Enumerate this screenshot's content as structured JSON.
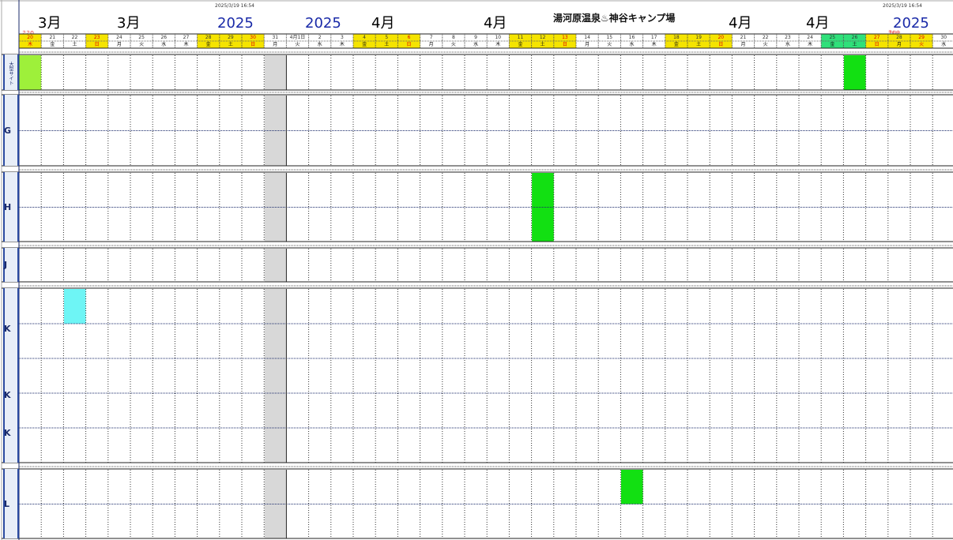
{
  "sheet": {
    "timestamp": "2025/3/19 16:54",
    "title": "湯河原温泉♨神谷キャンプ場",
    "banner": [
      "3月",
      "3月",
      "2025",
      "2025",
      "4月",
      "4月",
      "4月",
      "4月",
      "2025"
    ],
    "notes": {
      "left": "ささの",
      "right": "予約中"
    }
  },
  "days": [
    {
      "d": "20",
      "w": "木",
      "c": "#f5e400",
      "red": true
    },
    {
      "d": "21",
      "w": "金",
      "c": null,
      "red": false
    },
    {
      "d": "22",
      "w": "土",
      "c": null,
      "red": false
    },
    {
      "d": "23",
      "w": "日",
      "c": "#f5e400",
      "red": true
    },
    {
      "d": "24",
      "w": "月",
      "c": null,
      "red": false
    },
    {
      "d": "25",
      "w": "火",
      "c": null,
      "red": false
    },
    {
      "d": "26",
      "w": "水",
      "c": null,
      "red": false
    },
    {
      "d": "27",
      "w": "木",
      "c": null,
      "red": false
    },
    {
      "d": "28",
      "w": "金",
      "c": "#f5e400",
      "red": false
    },
    {
      "d": "29",
      "w": "土",
      "c": "#f5e400",
      "red": false
    },
    {
      "d": "30",
      "w": "日",
      "c": "#f5e400",
      "red": true
    },
    {
      "d": "31",
      "w": "月",
      "c": null,
      "red": false
    },
    {
      "d": "4月1日",
      "w": "火",
      "c": null,
      "red": false
    },
    {
      "d": "2",
      "w": "水",
      "c": null,
      "red": false
    },
    {
      "d": "3",
      "w": "木",
      "c": null,
      "red": false
    },
    {
      "d": "4",
      "w": "金",
      "c": "#f5e400",
      "red": false
    },
    {
      "d": "5",
      "w": "土",
      "c": "#f5e400",
      "red": false
    },
    {
      "d": "6",
      "w": "日",
      "c": "#f5e400",
      "red": true
    },
    {
      "d": "7",
      "w": "月",
      "c": null,
      "red": false
    },
    {
      "d": "8",
      "w": "火",
      "c": null,
      "red": false
    },
    {
      "d": "9",
      "w": "水",
      "c": null,
      "red": false
    },
    {
      "d": "10",
      "w": "木",
      "c": null,
      "red": false
    },
    {
      "d": "11",
      "w": "金",
      "c": "#f5e400",
      "red": false
    },
    {
      "d": "12",
      "w": "土",
      "c": "#f5e400",
      "red": false
    },
    {
      "d": "13",
      "w": "日",
      "c": "#f5e400",
      "red": true
    },
    {
      "d": "14",
      "w": "月",
      "c": null,
      "red": false
    },
    {
      "d": "15",
      "w": "火",
      "c": null,
      "red": false
    },
    {
      "d": "16",
      "w": "水",
      "c": null,
      "red": false
    },
    {
      "d": "17",
      "w": "木",
      "c": null,
      "red": false
    },
    {
      "d": "18",
      "w": "金",
      "c": "#f5e400",
      "red": false
    },
    {
      "d": "19",
      "w": "土",
      "c": "#f5e400",
      "red": false
    },
    {
      "d": "20",
      "w": "日",
      "c": "#f5e400",
      "red": true
    },
    {
      "d": "21",
      "w": "月",
      "c": null,
      "red": false
    },
    {
      "d": "22",
      "w": "火",
      "c": null,
      "red": false
    },
    {
      "d": "23",
      "w": "水",
      "c": null,
      "red": false
    },
    {
      "d": "24",
      "w": "木",
      "c": null,
      "red": false
    },
    {
      "d": "25",
      "w": "金",
      "c": "#2fe07a",
      "red": false
    },
    {
      "d": "26",
      "w": "土",
      "c": "#2fe07a",
      "red": false
    },
    {
      "d": "27",
      "w": "日",
      "c": "#f5e400",
      "red": true
    },
    {
      "d": "28",
      "w": "月",
      "c": "#f5e400",
      "red": false
    },
    {
      "d": "29",
      "w": "火",
      "c": "#f5e400",
      "red": true
    },
    {
      "d": "30",
      "w": "水",
      "c": null,
      "red": false
    }
  ],
  "sections": [
    {
      "letter": "",
      "vertical": "大型サイト",
      "label_top": "大",
      "rows": 1
    },
    {
      "letter": "G",
      "rows": 2
    },
    {
      "letter": "H",
      "rows": 2
    },
    {
      "letter": "J",
      "rows": 1
    },
    {
      "letter": "K",
      "rows": 5,
      "sub_letters": [
        "K",
        "K",
        "K"
      ]
    },
    {
      "letter": "L",
      "rows": 2
    }
  ],
  "reservations": [
    {
      "name": "res-large-1",
      "color": "#9ef03a",
      "section": 0,
      "col": 0
    },
    {
      "name": "res-large-2",
      "color": "#12e012",
      "section": 0,
      "col": 37
    },
    {
      "name": "res-h-1",
      "color": "#12e012",
      "section": 2,
      "col": 23
    },
    {
      "name": "res-k-1",
      "color": "#6ef5f5",
      "section": 4,
      "col": 2
    },
    {
      "name": "res-l-1",
      "color": "#12e012",
      "section": 5,
      "col": 27
    }
  ],
  "colors": {
    "weekend": "#f5e400",
    "alt": "#2fe07a",
    "grid": "#444",
    "shade": "#d8d8d8"
  }
}
